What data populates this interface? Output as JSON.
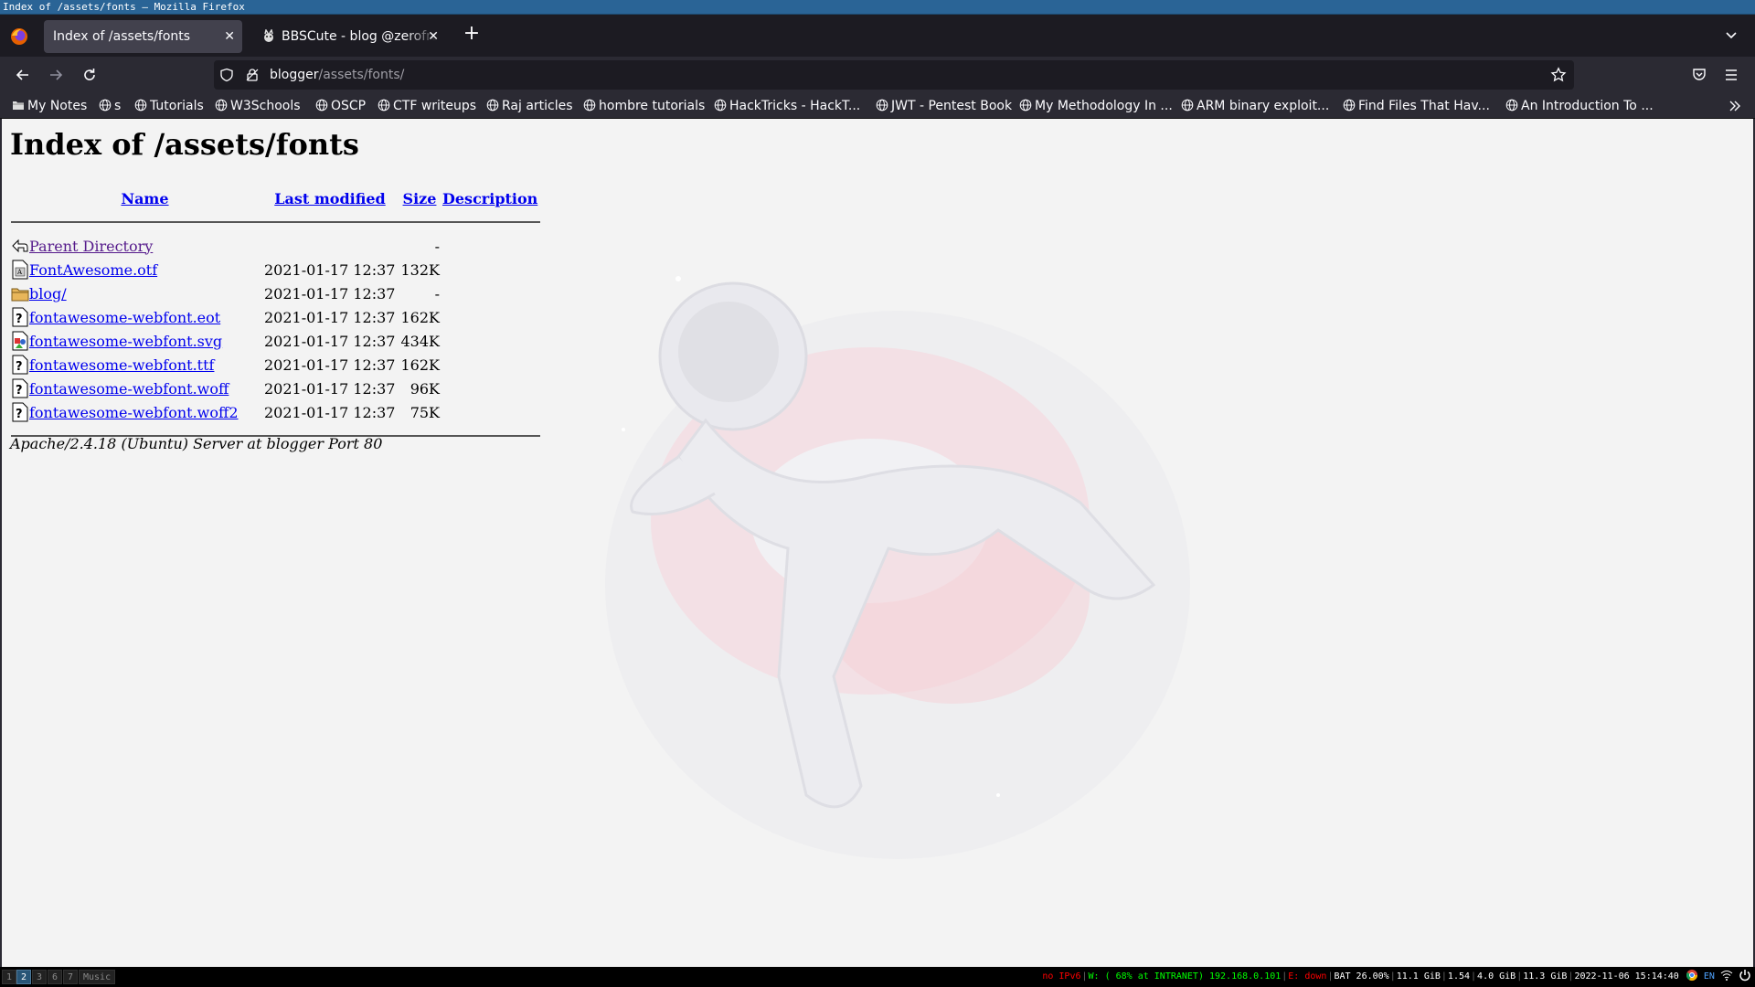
{
  "window": {
    "title": "Index of /assets/fonts — Mozilla Firefox"
  },
  "tabs": [
    {
      "label": "Index of /assets/fonts",
      "active": true
    },
    {
      "label": "BBSCute - blog @zerofrost",
      "active": false
    }
  ],
  "urlbar": {
    "host": "blogger",
    "path": "/assets/fonts/"
  },
  "bookmarks": [
    {
      "label": "My Notes",
      "icon": "folder-icon"
    },
    {
      "label": "s",
      "icon": "globe-icon"
    },
    {
      "label": "Tutorials",
      "icon": "globe-icon"
    },
    {
      "label": "W3Schools",
      "icon": "globe-icon"
    },
    {
      "label": "OSCP",
      "icon": "globe-icon"
    },
    {
      "label": "CTF writeups",
      "icon": "globe-icon"
    },
    {
      "label": "Raj articles",
      "icon": "globe-icon"
    },
    {
      "label": "hombre tutorials",
      "icon": "globe-icon"
    },
    {
      "label": "HackTricks - HackT...",
      "icon": "globe-icon"
    },
    {
      "label": "JWT - Pentest Book",
      "icon": "globe-icon"
    },
    {
      "label": "My Methodology In ...",
      "icon": "globe-icon"
    },
    {
      "label": "ARM binary exploit...",
      "icon": "globe-icon"
    },
    {
      "label": "Find Files That Hav...",
      "icon": "globe-icon"
    },
    {
      "label": "An Introduction To ...",
      "icon": "globe-icon"
    }
  ],
  "page": {
    "heading": "Index of /assets/fonts",
    "columns": {
      "name": "Name",
      "modified": "Last modified",
      "size": "Size",
      "description": "Description"
    },
    "parent": {
      "name": "Parent Directory",
      "size": "-"
    },
    "rows": [
      {
        "name": "FontAwesome.otf",
        "modified": "2021-01-17 12:37",
        "size": "132K",
        "icon": "font-file-icon"
      },
      {
        "name": "blog/",
        "modified": "2021-01-17 12:37",
        "size": "-",
        "icon": "folder-icon"
      },
      {
        "name": "fontawesome-webfont.eot",
        "modified": "2021-01-17 12:37",
        "size": "162K",
        "icon": "unknown-file-icon"
      },
      {
        "name": "fontawesome-webfont.svg",
        "modified": "2021-01-17 12:37",
        "size": "434K",
        "icon": "image-file-icon"
      },
      {
        "name": "fontawesome-webfont.ttf",
        "modified": "2021-01-17 12:37",
        "size": "162K",
        "icon": "unknown-file-icon"
      },
      {
        "name": "fontawesome-webfont.woff",
        "modified": "2021-01-17 12:37",
        "size": "96K",
        "icon": "unknown-file-icon"
      },
      {
        "name": "fontawesome-webfont.woff2",
        "modified": "2021-01-17 12:37",
        "size": "75K",
        "icon": "unknown-file-icon"
      }
    ],
    "footer": "Apache/2.4.18 (Ubuntu) Server at blogger Port 80"
  },
  "statusbar": {
    "workspaces": [
      "1",
      "2",
      "3",
      "6",
      "7",
      "Music"
    ],
    "focused_workspace": "2",
    "ipv6": "no IPv6",
    "wifi": "W: ( 68% at INTRANET) 192.168.0.101",
    "ethernet": "E: down",
    "battery": "BAT 26.00%",
    "disk": "11.1 GiB",
    "load": "1.54",
    "memory": "4.0 GiB",
    "swap": "11.3 GiB",
    "datetime": "2022-11-06 15:14:40",
    "lang": "EN"
  },
  "colors": {
    "link": "#0000ee",
    "visited": "#551a8b",
    "ipv6_red": "#ff0000",
    "wifi_green": "#00ff00"
  }
}
